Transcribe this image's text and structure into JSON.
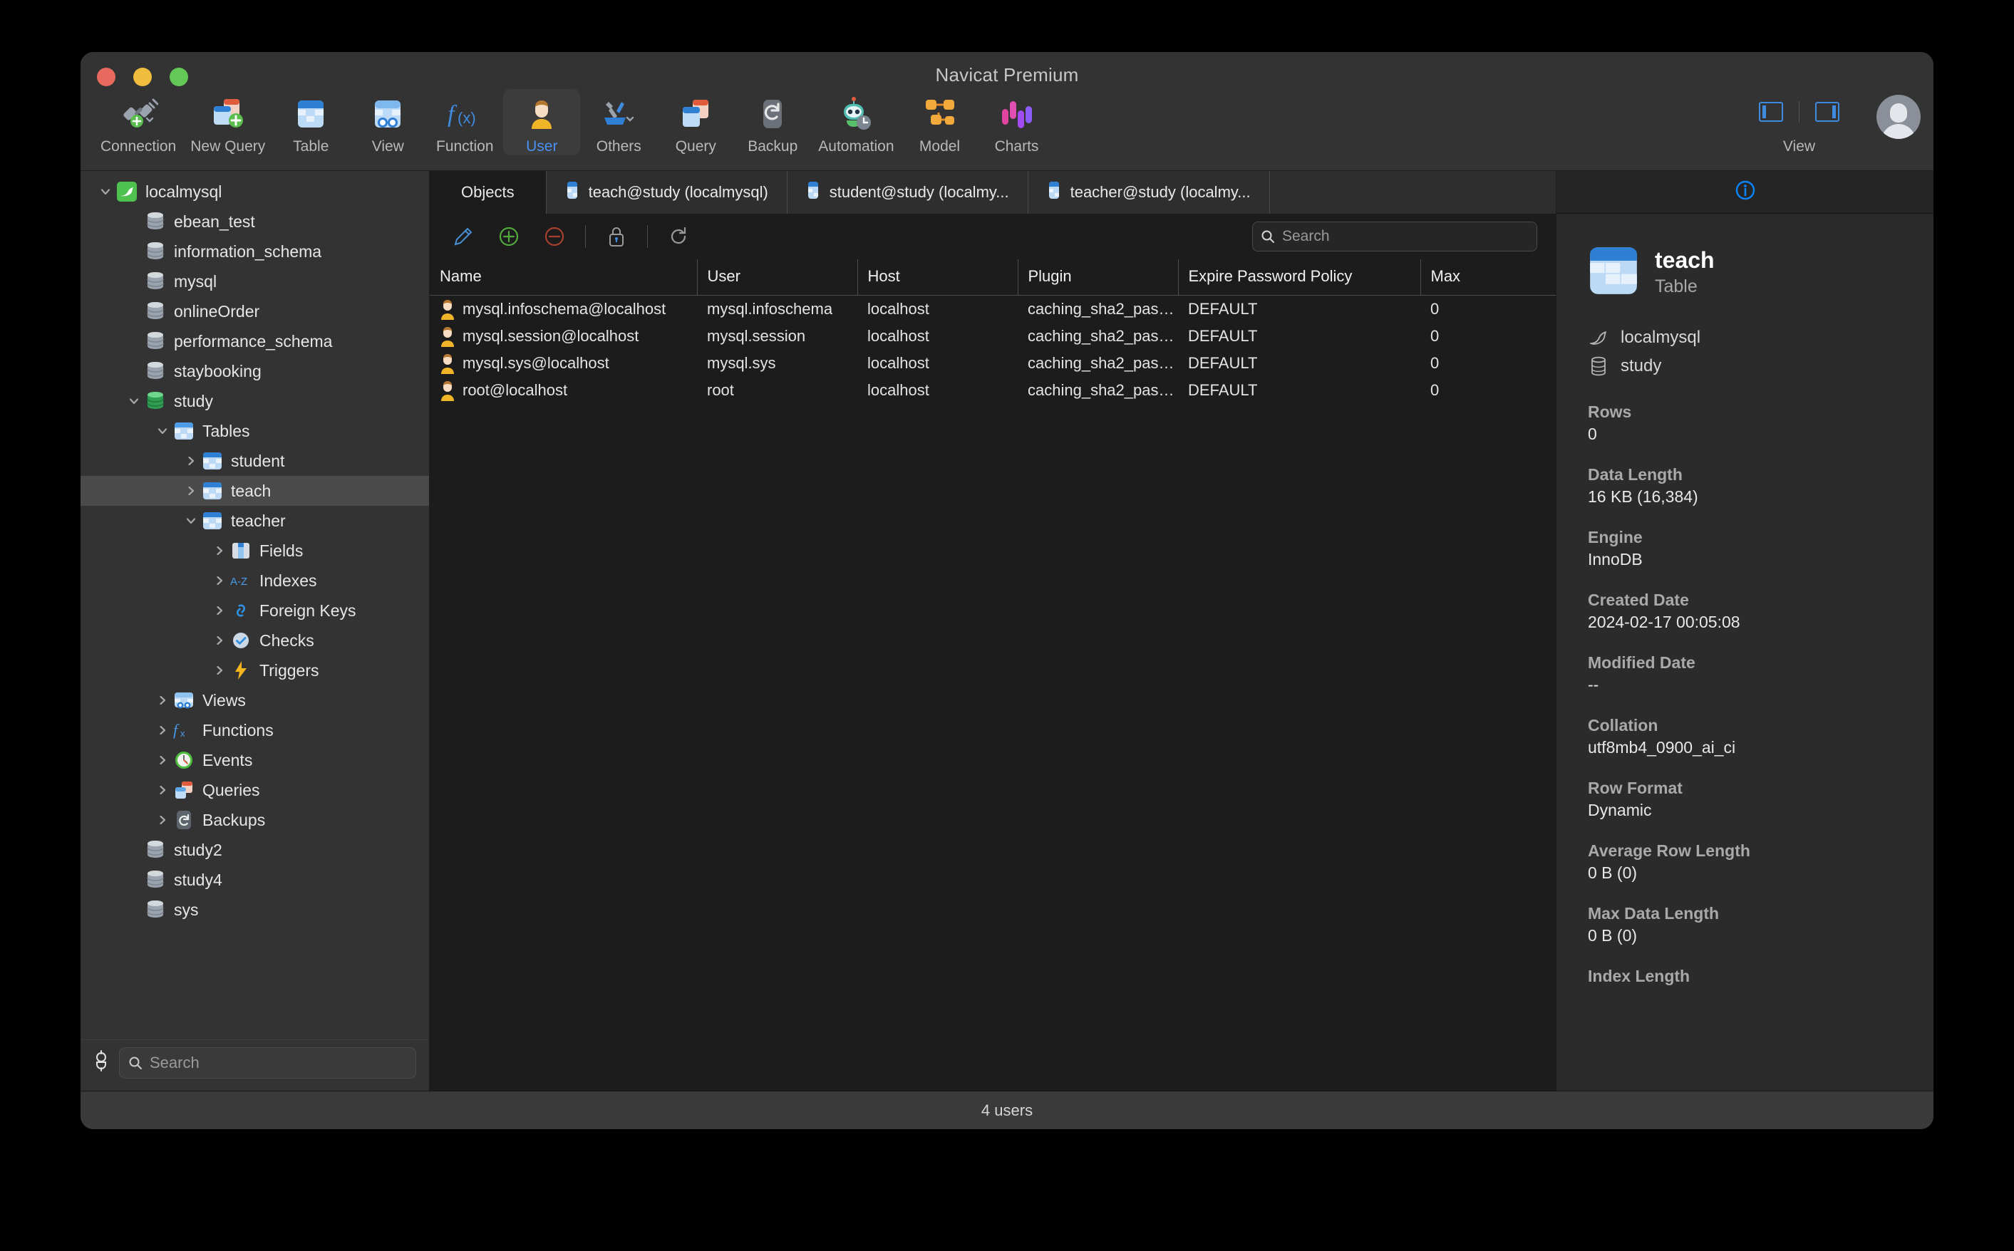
{
  "window": {
    "title": "Navicat Premium"
  },
  "toolbar": {
    "items": [
      {
        "label": "Connection",
        "icon": "connection-icon"
      },
      {
        "label": "New Query",
        "icon": "new-query-icon"
      },
      {
        "label": "Table",
        "icon": "table-icon"
      },
      {
        "label": "View",
        "icon": "view-icon"
      },
      {
        "label": "Function",
        "icon": "function-icon"
      },
      {
        "label": "User",
        "icon": "user-icon"
      },
      {
        "label": "Others",
        "icon": "others-icon"
      },
      {
        "label": "Query",
        "icon": "query-icon"
      },
      {
        "label": "Backup",
        "icon": "backup-icon"
      },
      {
        "label": "Automation",
        "icon": "automation-icon"
      },
      {
        "label": "Model",
        "icon": "model-icon"
      },
      {
        "label": "Charts",
        "icon": "charts-icon"
      }
    ],
    "active": "User",
    "view_label": "View"
  },
  "sidebar": {
    "search_placeholder": "Search",
    "items": [
      {
        "label": "localmysql",
        "indent": 0,
        "twisty": "down",
        "icon": "mysql-dolphin-icon",
        "selected": false
      },
      {
        "label": "ebean_test",
        "indent": 1,
        "twisty": "none",
        "icon": "database-gray-icon",
        "selected": false
      },
      {
        "label": "information_schema",
        "indent": 1,
        "twisty": "none",
        "icon": "database-gray-icon",
        "selected": false
      },
      {
        "label": "mysql",
        "indent": 1,
        "twisty": "none",
        "icon": "database-gray-icon",
        "selected": false
      },
      {
        "label": "onlineOrder",
        "indent": 1,
        "twisty": "none",
        "icon": "database-gray-icon",
        "selected": false
      },
      {
        "label": "performance_schema",
        "indent": 1,
        "twisty": "none",
        "icon": "database-gray-icon",
        "selected": false
      },
      {
        "label": "staybooking",
        "indent": 1,
        "twisty": "none",
        "icon": "database-gray-icon",
        "selected": false
      },
      {
        "label": "study",
        "indent": 1,
        "twisty": "down",
        "icon": "database-green-icon",
        "selected": false
      },
      {
        "label": "Tables",
        "indent": 2,
        "twisty": "down",
        "icon": "tables-icon",
        "selected": false
      },
      {
        "label": "student",
        "indent": 3,
        "twisty": "right",
        "icon": "table-blue-icon",
        "selected": false
      },
      {
        "label": "teach",
        "indent": 3,
        "twisty": "right",
        "icon": "table-blue-icon",
        "selected": true
      },
      {
        "label": "teacher",
        "indent": 3,
        "twisty": "down",
        "icon": "table-blue-icon",
        "selected": false
      },
      {
        "label": "Fields",
        "indent": 4,
        "twisty": "right",
        "icon": "fields-icon",
        "selected": false
      },
      {
        "label": "Indexes",
        "indent": 4,
        "twisty": "right",
        "icon": "indexes-az-icon",
        "selected": false
      },
      {
        "label": "Foreign Keys",
        "indent": 4,
        "twisty": "right",
        "icon": "foreign-keys-icon",
        "selected": false
      },
      {
        "label": "Checks",
        "indent": 4,
        "twisty": "right",
        "icon": "checks-icon",
        "selected": false
      },
      {
        "label": "Triggers",
        "indent": 4,
        "twisty": "right",
        "icon": "triggers-icon",
        "selected": false
      },
      {
        "label": "Views",
        "indent": 2,
        "twisty": "right",
        "icon": "views-icon",
        "selected": false
      },
      {
        "label": "Functions",
        "indent": 2,
        "twisty": "right",
        "icon": "functions-fx-icon",
        "selected": false
      },
      {
        "label": "Events",
        "indent": 2,
        "twisty": "right",
        "icon": "events-clock-icon",
        "selected": false
      },
      {
        "label": "Queries",
        "indent": 2,
        "twisty": "right",
        "icon": "queries-icon",
        "selected": false
      },
      {
        "label": "Backups",
        "indent": 2,
        "twisty": "right",
        "icon": "backups-icon",
        "selected": false
      },
      {
        "label": "study2",
        "indent": 1,
        "twisty": "none",
        "icon": "database-gray-icon",
        "selected": false
      },
      {
        "label": "study4",
        "indent": 1,
        "twisty": "none",
        "icon": "database-gray-icon",
        "selected": false
      },
      {
        "label": "sys",
        "indent": 1,
        "twisty": "none",
        "icon": "database-gray-icon",
        "selected": false
      }
    ]
  },
  "tabs": [
    {
      "label": "Objects",
      "icon": "none",
      "active": true
    },
    {
      "label": "teach@study (localmysql)",
      "icon": "table-blue-icon",
      "active": false
    },
    {
      "label": "student@study (localmy...",
      "icon": "table-blue-icon",
      "active": false
    },
    {
      "label": "teacher@study (localmy...",
      "icon": "table-blue-icon",
      "active": false
    }
  ],
  "object_toolbar": {
    "buttons": [
      {
        "name": "edit-user-button",
        "icon": "pencil-icon"
      },
      {
        "name": "add-user-button",
        "icon": "plus-circle-icon"
      },
      {
        "name": "delete-user-button",
        "icon": "minus-circle-icon"
      },
      {
        "name": "privileges-button",
        "icon": "lock-icon"
      },
      {
        "name": "refresh-button",
        "icon": "refresh-icon"
      }
    ],
    "search_placeholder": "Search"
  },
  "table": {
    "columns": [
      "Name",
      "User",
      "Host",
      "Plugin",
      "Expire Password Policy",
      "Max"
    ],
    "rows": [
      {
        "name": "mysql.infoschema@localhost",
        "user": "mysql.infoschema",
        "host": "localhost",
        "plugin": "caching_sha2_pas…",
        "expire": "DEFAULT",
        "max": "0"
      },
      {
        "name": "mysql.session@localhost",
        "user": "mysql.session",
        "host": "localhost",
        "plugin": "caching_sha2_pas…",
        "expire": "DEFAULT",
        "max": "0"
      },
      {
        "name": "mysql.sys@localhost",
        "user": "mysql.sys",
        "host": "localhost",
        "plugin": "caching_sha2_pas…",
        "expire": "DEFAULT",
        "max": "0"
      },
      {
        "name": "root@localhost",
        "user": "root",
        "host": "localhost",
        "plugin": "caching_sha2_pas…",
        "expire": "DEFAULT",
        "max": "0"
      }
    ]
  },
  "info_panel": {
    "tab_icon": "info-circle-icon",
    "object_name": "teach",
    "object_type": "Table",
    "connection": "localmysql",
    "database": "study",
    "properties": [
      {
        "key": "Rows",
        "value": "0"
      },
      {
        "key": "Data Length",
        "value": "16 KB (16,384)"
      },
      {
        "key": "Engine",
        "value": "InnoDB"
      },
      {
        "key": "Created Date",
        "value": "2024-02-17 00:05:08"
      },
      {
        "key": "Modified Date",
        "value": "--"
      },
      {
        "key": "Collation",
        "value": "utf8mb4_0900_ai_ci"
      },
      {
        "key": "Row Format",
        "value": "Dynamic"
      },
      {
        "key": "Average Row Length",
        "value": "0 B (0)"
      },
      {
        "key": "Max Data Length",
        "value": "0 B (0)"
      },
      {
        "key": "Index Length",
        "value": ""
      }
    ]
  },
  "status_bar": {
    "text": "4 users"
  },
  "colors": {
    "accent": "#4a90f0",
    "window_bg": "#2b2b2b",
    "panel_bg": "#333333",
    "content_bg": "#1c1c1c",
    "selection": "#4a4a4a"
  }
}
